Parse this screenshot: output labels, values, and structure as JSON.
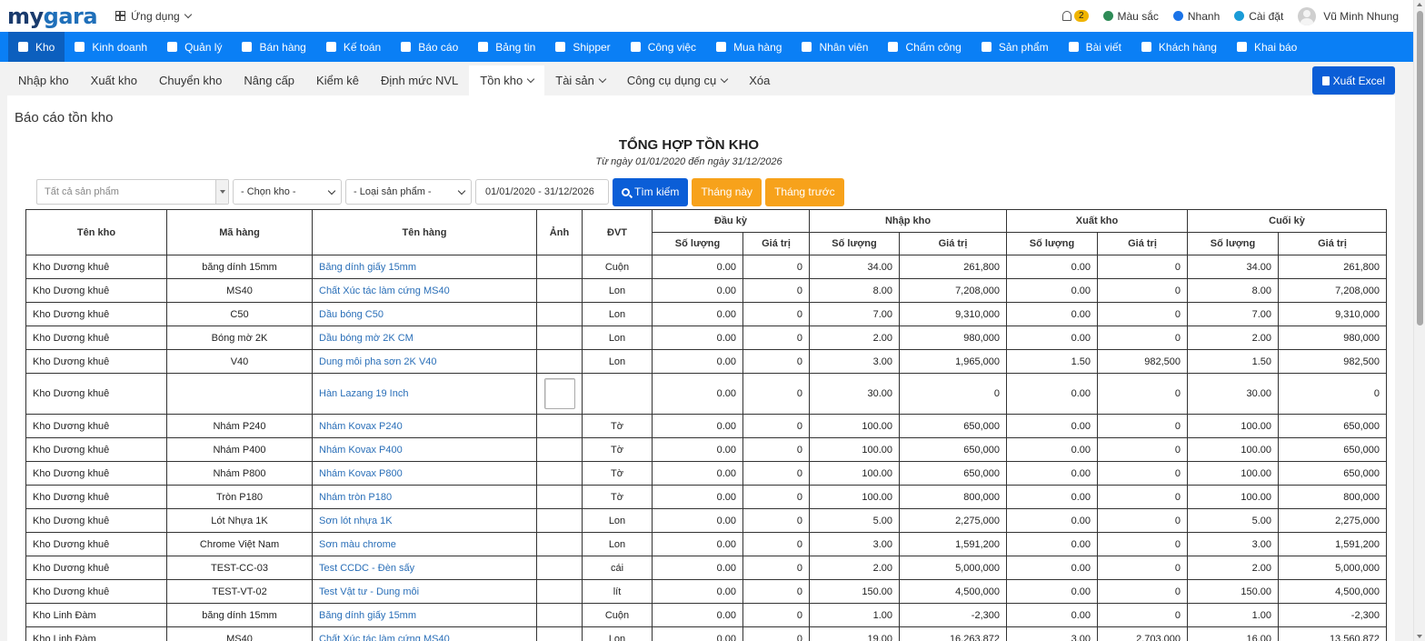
{
  "header": {
    "logo_main": "my",
    "logo_accent": "gara",
    "apps_label": "Ứng dụng",
    "notification_count": "2",
    "items": [
      {
        "label": "Màu sắc",
        "icon": "palette-icon",
        "color": "#2e8b57"
      },
      {
        "label": "Nhanh",
        "icon": "bolt-icon",
        "color": "#1a73e8"
      },
      {
        "label": "Cài đặt",
        "icon": "gear-icon",
        "color": "#1a9bd7"
      }
    ],
    "user_name": "Vũ Minh Nhung"
  },
  "main_menu": [
    {
      "label": "Kho",
      "icon": "warehouse-icon",
      "active": true
    },
    {
      "label": "Kinh doanh",
      "icon": "shopping-bag-icon"
    },
    {
      "label": "Quản lý",
      "icon": "id-card-icon"
    },
    {
      "label": "Bán hàng",
      "icon": "cart-icon"
    },
    {
      "label": "Kế toán",
      "icon": "dollar-icon"
    },
    {
      "label": "Báo cáo",
      "icon": "pie-chart-icon"
    },
    {
      "label": "Bảng tin",
      "icon": "megaphone-icon"
    },
    {
      "label": "Shipper",
      "icon": "truck-icon"
    },
    {
      "label": "Công việc",
      "icon": "calendar-icon"
    },
    {
      "label": "Mua hàng",
      "icon": "basket-icon"
    },
    {
      "label": "Nhân viên",
      "icon": "user-icon"
    },
    {
      "label": "Chấm công",
      "icon": "calendar-check-icon"
    },
    {
      "label": "Sản phẩm",
      "icon": "box-icon"
    },
    {
      "label": "Bài viết",
      "icon": "newspaper-icon"
    },
    {
      "label": "Khách hàng",
      "icon": "smile-icon"
    },
    {
      "label": "Khai báo",
      "icon": "list-icon"
    }
  ],
  "sub_tabs": [
    {
      "label": "Nhập kho"
    },
    {
      "label": "Xuất kho"
    },
    {
      "label": "Chuyển kho"
    },
    {
      "label": "Nâng cấp"
    },
    {
      "label": "Kiểm kê"
    },
    {
      "label": "Định mức NVL"
    },
    {
      "label": "Tồn kho",
      "active": true,
      "dropdown": true
    },
    {
      "label": "Tài sản",
      "dropdown": true
    },
    {
      "label": "Công cụ dụng cụ",
      "dropdown": true
    },
    {
      "label": "Xóa"
    }
  ],
  "export_button": "Xuất Excel",
  "page_title": "Báo cáo tồn kho",
  "report": {
    "title": "TỔNG HỢP TỒN KHO",
    "subtitle": "Từ ngày 01/01/2020 đến ngày 31/12/2026"
  },
  "filters": {
    "product_placeholder": "Tất cả sản phẩm",
    "warehouse_select": "- Chọn kho -",
    "type_select": "- Loại sản phẩm -",
    "date_range": "01/01/2020 - 31/12/2026",
    "search_button": "Tìm kiếm",
    "this_month_button": "Tháng này",
    "last_month_button": "Tháng trước"
  },
  "table": {
    "headers": {
      "warehouse": "Tên kho",
      "code": "Mã hàng",
      "name": "Tên hàng",
      "image": "Ảnh",
      "unit": "ĐVT",
      "opening": "Đầu kỳ",
      "import": "Nhập kho",
      "export": "Xuất kho",
      "closing": "Cuối kỳ",
      "qty": "Số lượng",
      "value": "Giá trị"
    },
    "rows": [
      {
        "warehouse": "Kho Dương khuê",
        "code": "băng dính 15mm",
        "name": "Băng dính giấy 15mm",
        "image": false,
        "unit": "Cuộn",
        "open_qty": "0.00",
        "open_val": "0",
        "in_qty": "34.00",
        "in_val": "261,800",
        "out_qty": "0.00",
        "out_val": "0",
        "close_qty": "34.00",
        "close_val": "261,800"
      },
      {
        "warehouse": "Kho Dương khuê",
        "code": "MS40",
        "name": "Chất Xúc tác làm cứng MS40",
        "image": false,
        "unit": "Lon",
        "open_qty": "0.00",
        "open_val": "0",
        "in_qty": "8.00",
        "in_val": "7,208,000",
        "out_qty": "0.00",
        "out_val": "0",
        "close_qty": "8.00",
        "close_val": "7,208,000"
      },
      {
        "warehouse": "Kho Dương khuê",
        "code": "C50",
        "name": "Dầu bóng C50",
        "image": false,
        "unit": "Lon",
        "open_qty": "0.00",
        "open_val": "0",
        "in_qty": "7.00",
        "in_val": "9,310,000",
        "out_qty": "0.00",
        "out_val": "0",
        "close_qty": "7.00",
        "close_val": "9,310,000"
      },
      {
        "warehouse": "Kho Dương khuê",
        "code": "Bóng mờ 2K",
        "name": "Dầu bóng mờ 2K CM",
        "image": false,
        "unit": "Lon",
        "open_qty": "0.00",
        "open_val": "0",
        "in_qty": "2.00",
        "in_val": "980,000",
        "out_qty": "0.00",
        "out_val": "0",
        "close_qty": "2.00",
        "close_val": "980,000"
      },
      {
        "warehouse": "Kho Dương khuê",
        "code": "V40",
        "name": "Dung môi pha sơn 2K V40",
        "image": false,
        "unit": "Lon",
        "open_qty": "0.00",
        "open_val": "0",
        "in_qty": "3.00",
        "in_val": "1,965,000",
        "out_qty": "1.50",
        "out_val": "982,500",
        "close_qty": "1.50",
        "close_val": "982,500"
      },
      {
        "warehouse": "Kho Dương khuê",
        "code": "",
        "name": "Hàn Lazang 19 Inch",
        "image": true,
        "unit": "",
        "open_qty": "0.00",
        "open_val": "0",
        "in_qty": "30.00",
        "in_val": "0",
        "out_qty": "0.00",
        "out_val": "0",
        "close_qty": "30.00",
        "close_val": "0"
      },
      {
        "warehouse": "Kho Dương khuê",
        "code": "Nhám P240",
        "name": "Nhám Kovax P240",
        "image": false,
        "unit": "Tờ",
        "open_qty": "0.00",
        "open_val": "0",
        "in_qty": "100.00",
        "in_val": "650,000",
        "out_qty": "0.00",
        "out_val": "0",
        "close_qty": "100.00",
        "close_val": "650,000"
      },
      {
        "warehouse": "Kho Dương khuê",
        "code": "Nhám P400",
        "name": "Nhám Kovax P400",
        "image": false,
        "unit": "Tờ",
        "open_qty": "0.00",
        "open_val": "0",
        "in_qty": "100.00",
        "in_val": "650,000",
        "out_qty": "0.00",
        "out_val": "0",
        "close_qty": "100.00",
        "close_val": "650,000"
      },
      {
        "warehouse": "Kho Dương khuê",
        "code": "Nhám P800",
        "name": "Nhám Kovax P800",
        "image": false,
        "unit": "Tờ",
        "open_qty": "0.00",
        "open_val": "0",
        "in_qty": "100.00",
        "in_val": "650,000",
        "out_qty": "0.00",
        "out_val": "0",
        "close_qty": "100.00",
        "close_val": "650,000"
      },
      {
        "warehouse": "Kho Dương khuê",
        "code": "Tròn P180",
        "name": "Nhám tròn P180",
        "image": false,
        "unit": "Tờ",
        "open_qty": "0.00",
        "open_val": "0",
        "in_qty": "100.00",
        "in_val": "800,000",
        "out_qty": "0.00",
        "out_val": "0",
        "close_qty": "100.00",
        "close_val": "800,000"
      },
      {
        "warehouse": "Kho Dương khuê",
        "code": "Lót Nhựa 1K",
        "name": "Sơn lót nhựa 1K",
        "image": false,
        "unit": "Lon",
        "open_qty": "0.00",
        "open_val": "0",
        "in_qty": "5.00",
        "in_val": "2,275,000",
        "out_qty": "0.00",
        "out_val": "0",
        "close_qty": "5.00",
        "close_val": "2,275,000"
      },
      {
        "warehouse": "Kho Dương khuê",
        "code": "Chrome Việt Nam",
        "name": "Sơn màu chrome",
        "image": false,
        "unit": "Lon",
        "open_qty": "0.00",
        "open_val": "0",
        "in_qty": "3.00",
        "in_val": "1,591,200",
        "out_qty": "0.00",
        "out_val": "0",
        "close_qty": "3.00",
        "close_val": "1,591,200"
      },
      {
        "warehouse": "Kho Dương khuê",
        "code": "TEST-CC-03",
        "name": "Test CCDC - Đèn sấy",
        "image": false,
        "unit": "cái",
        "open_qty": "0.00",
        "open_val": "0",
        "in_qty": "2.00",
        "in_val": "5,000,000",
        "out_qty": "0.00",
        "out_val": "0",
        "close_qty": "2.00",
        "close_val": "5,000,000"
      },
      {
        "warehouse": "Kho Dương khuê",
        "code": "TEST-VT-02",
        "name": "Test Vật tư - Dung môi",
        "image": false,
        "unit": "lít",
        "open_qty": "0.00",
        "open_val": "0",
        "in_qty": "150.00",
        "in_val": "4,500,000",
        "out_qty": "0.00",
        "out_val": "0",
        "close_qty": "150.00",
        "close_val": "4,500,000"
      },
      {
        "warehouse": "Kho Linh Đàm",
        "code": "băng dính 15mm",
        "name": "Băng dính giấy 15mm",
        "image": false,
        "unit": "Cuộn",
        "open_qty": "0.00",
        "open_val": "0",
        "in_qty": "1.00",
        "in_val": "-2,300",
        "out_qty": "0.00",
        "out_val": "0",
        "close_qty": "1.00",
        "close_val": "-2,300"
      },
      {
        "warehouse": "Kho Linh Đàm",
        "code": "MS40",
        "name": "Chất Xúc tác làm cứng MS40",
        "image": false,
        "unit": "Lon",
        "open_qty": "0.00",
        "open_val": "0",
        "in_qty": "19.00",
        "in_val": "16,263,872",
        "out_qty": "3.00",
        "out_val": "2,703,000",
        "close_qty": "16.00",
        "close_val": "13,560,872"
      }
    ]
  }
}
